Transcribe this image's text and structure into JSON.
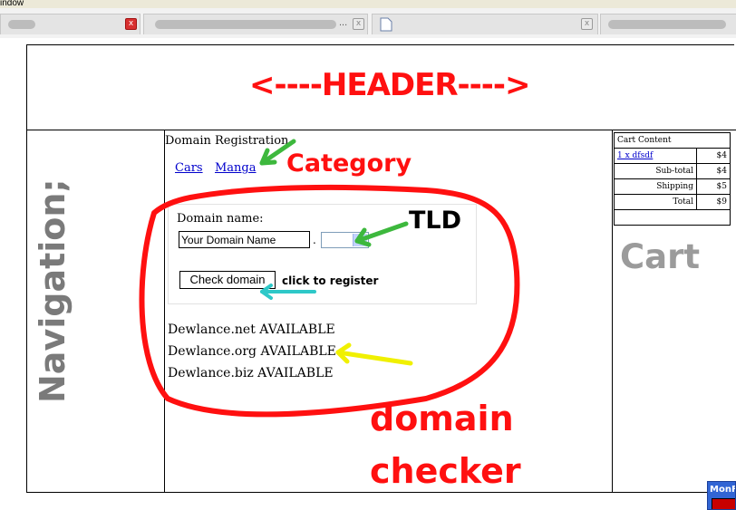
{
  "browser": {
    "title_fragment": "indow",
    "tabs": [
      {
        "close": "x",
        "close_style": "red"
      },
      {
        "label_tail": "...",
        "close": "x"
      },
      {
        "close": "x"
      },
      {
        "close": ""
      }
    ]
  },
  "header": {
    "label": "<----HEADER---->"
  },
  "navigation": {
    "label": "Navigation;"
  },
  "category": {
    "title": "Domain Registration",
    "links": [
      "Cars",
      "Manga"
    ],
    "annotation": "Category"
  },
  "form": {
    "domain_label": "Domain name:",
    "domain_value": "Your Domain Name",
    "dot": ".",
    "tld_annotation": "TLD",
    "check_button": "Check domain",
    "click_annotation": "click to register"
  },
  "results": [
    "Dewlance.net  AVAILABLE",
    "Dewlance.org  AVAILABLE",
    "Dewlance.biz  AVAILABLE"
  ],
  "checker_annotation": {
    "line1": "domain",
    "line2": "checker"
  },
  "cart": {
    "title": "Cart Content",
    "item": {
      "label": "1 x dfsdf",
      "price": "$4"
    },
    "subtotal": {
      "label": "Sub-total",
      "value": "$4"
    },
    "shipping": {
      "label": "Shipping",
      "value": "$5"
    },
    "total": {
      "label": "Total",
      "value": "$9"
    },
    "annotation": "Cart"
  },
  "corner_widget": {
    "label": "MonF"
  },
  "colors": {
    "annotation_red": "#ff1010",
    "arrow_green": "#3db83d",
    "arrow_cyan": "#2ec8c8",
    "arrow_yellow": "#f0f000",
    "link_blue": "#0000cc"
  }
}
